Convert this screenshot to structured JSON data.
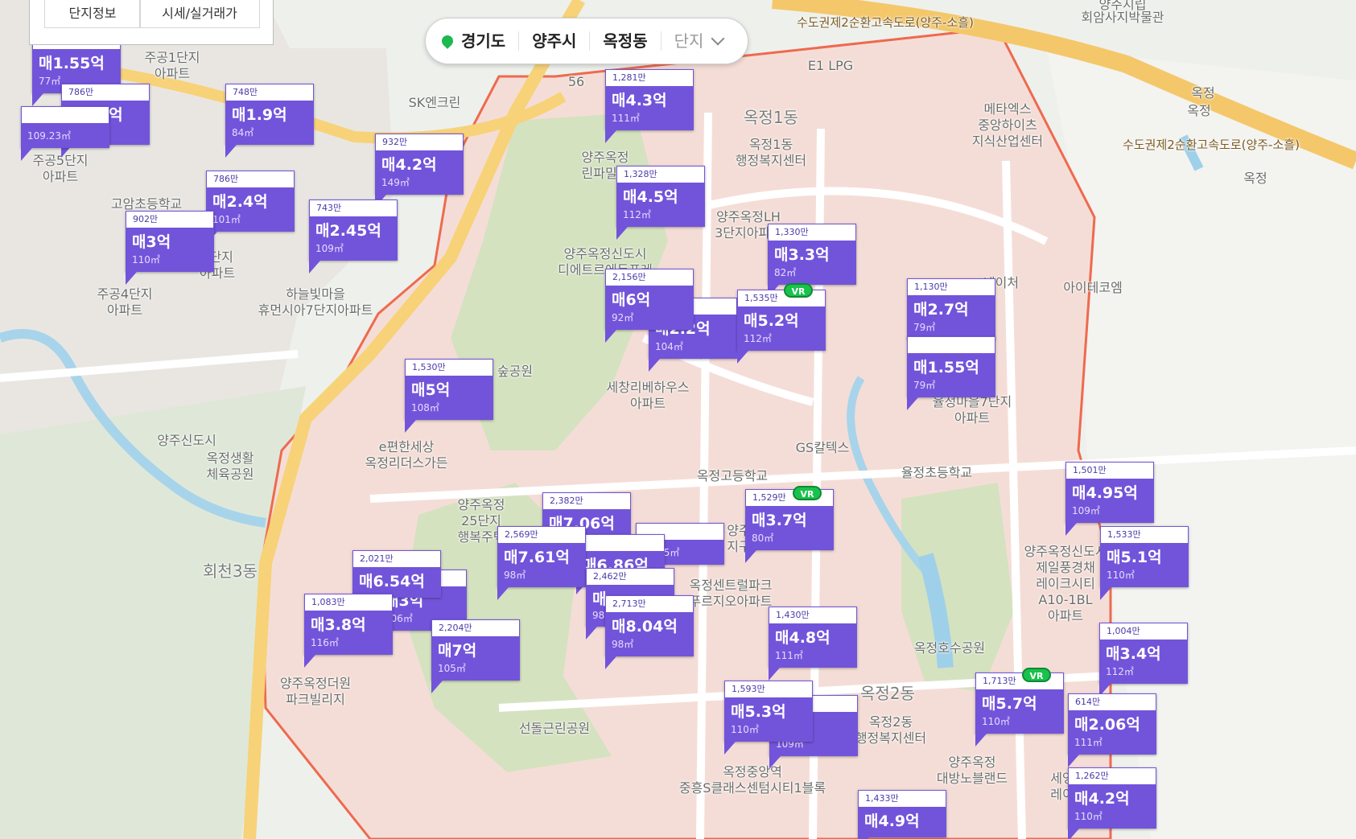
{
  "panel": {
    "tab_info": "단지정보",
    "tab_price": "시세/실거래가"
  },
  "region": {
    "province": "경기도",
    "city": "양주시",
    "dong": "옥정동",
    "complex_placeholder": "단지"
  },
  "vr_badge": "VR",
  "map_labels": [
    {
      "id": "road-expressway",
      "text": "수도권제2순환고속도로(양주-소흘)"
    },
    {
      "id": "museum",
      "text": "회암사지박물관"
    },
    {
      "id": "yangju-pass",
      "text": "양주시립"
    },
    {
      "id": "tg-okjeong-1",
      "text": "옥정"
    },
    {
      "id": "tg-okjeong-2",
      "text": "옥정"
    },
    {
      "id": "ic-okjeong",
      "text": "옥정"
    },
    {
      "id": "road-metro",
      "text": "수도권제2순환고속도로(양주-소흘)"
    },
    {
      "id": "e1-lpg",
      "text": "E1 LPG"
    },
    {
      "id": "sk-enclean",
      "text": "SK엔크린"
    },
    {
      "id": "jugong1",
      "text": "주공1단지\n아파트"
    },
    {
      "id": "jugong5",
      "text": "주공5단지\n아파트"
    },
    {
      "id": "goam-school",
      "text": "고암초등학교"
    },
    {
      "id": "jugong4",
      "text": "주공4단지\n아파트"
    },
    {
      "id": "jugong3",
      "text": "3단지\n아파트"
    },
    {
      "id": "haneulbit",
      "text": "하늘빛마을\n휴먼시아7단지아파트"
    },
    {
      "id": "okjeong1dong",
      "text": "옥정1동"
    },
    {
      "id": "okjeong1-center",
      "text": "옥정1동\n행정복지센터"
    },
    {
      "id": "meta-x",
      "text": "메타엑스\n중앙하이츠\n지식산업센터"
    },
    {
      "id": "rinpark",
      "text": "양주옥정\n린파밀리"
    },
    {
      "id": "lh3",
      "text": "양주옥정LH\n3단지아파트"
    },
    {
      "id": "dietre",
      "text": "양주옥정신도시\n디에트르에듀포레"
    },
    {
      "id": "aitechem",
      "text": "아이테코엠"
    },
    {
      "id": "nature",
      "text": "네이처"
    },
    {
      "id": "park-forest",
      "text": "숲공원"
    },
    {
      "id": "sechang",
      "text": "세창리베하우스\n아파트"
    },
    {
      "id": "yuljeong7",
      "text": "율정마을7단지\n아파트"
    },
    {
      "id": "yangju-newtown",
      "text": "양주신도시"
    },
    {
      "id": "okjeong-sports",
      "text": "옥정생활\n체육공원"
    },
    {
      "id": "epyeonhan",
      "text": "e편한세상\n옥정리더스가든"
    },
    {
      "id": "gs-caltex",
      "text": "GS칼텍스"
    },
    {
      "id": "okjeong-high",
      "text": "옥정고등학교"
    },
    {
      "id": "yuljeong-elem",
      "text": "율정초등학교"
    },
    {
      "id": "25danji",
      "text": "양주옥정\n25단지\n행복주택"
    },
    {
      "id": "hoecheon3",
      "text": "회천3동"
    },
    {
      "id": "jeil",
      "text": "양주옥정신도시\n제일풍경채\n레이크시티\nA10-1BL\n아파트"
    },
    {
      "id": "central-park",
      "text": "옥정센트럴파크\n푸르지오아파트"
    },
    {
      "id": "jigu",
      "text": "양주\n지구"
    },
    {
      "id": "lake-park",
      "text": "옥정호수공원"
    },
    {
      "id": "okjeong2dong",
      "text": "옥정2동"
    },
    {
      "id": "okjeong2-center",
      "text": "옥정2동\n행정복지센터"
    },
    {
      "id": "deowon",
      "text": "양주옥정더원\n파크빌리지"
    },
    {
      "id": "seondol",
      "text": "선돌근린공원"
    },
    {
      "id": "junghung",
      "text": "옥정중앙역\n중흥S클래스센텀시티1블록"
    },
    {
      "id": "daebang",
      "text": "양주옥정\n대방노블랜드"
    },
    {
      "id": "seyeong",
      "text": "세영\n레이"
    },
    {
      "id": "route56",
      "text": "56"
    }
  ],
  "listings": [
    {
      "id": "m01",
      "unit": "",
      "price": "매1.55억",
      "area": "77㎡"
    },
    {
      "id": "m02",
      "unit": "786만",
      "price": "매1.9억",
      "area": "82㎡"
    },
    {
      "id": "m03",
      "unit": "",
      "price": "",
      "area": "109.23㎡"
    },
    {
      "id": "m04",
      "unit": "748만",
      "price": "매1.9억",
      "area": "84㎡"
    },
    {
      "id": "m05",
      "unit": "932만",
      "price": "매4.2억",
      "area": "149㎡"
    },
    {
      "id": "m06",
      "unit": "786만",
      "price": "매2.4억",
      "area": "101㎡"
    },
    {
      "id": "m07",
      "unit": "743만",
      "price": "매2.45억",
      "area": "109㎡"
    },
    {
      "id": "m08",
      "unit": "902만",
      "price": "매3억",
      "area": "110㎡"
    },
    {
      "id": "m09",
      "unit": "1,281만",
      "price": "매4.3억",
      "area": "111㎡"
    },
    {
      "id": "m10",
      "unit": "1,328만",
      "price": "매4.5억",
      "area": "112㎡"
    },
    {
      "id": "m11",
      "unit": "1,330만",
      "price": "매3.3억",
      "area": "82㎡"
    },
    {
      "id": "m12",
      "unit": "",
      "price": "매2.2억",
      "area": "104㎡"
    },
    {
      "id": "m13",
      "unit": "2,156만",
      "price": "매6억",
      "area": "92㎡"
    },
    {
      "id": "m14",
      "unit": "1,535만",
      "price": "매5.2억",
      "area": "112㎡"
    },
    {
      "id": "m15",
      "unit": "1,130만",
      "price": "매2.7억",
      "area": "79㎡"
    },
    {
      "id": "m16",
      "unit": "",
      "price": "매1.55억",
      "area": "79㎡"
    },
    {
      "id": "m17",
      "unit": "1,530만",
      "price": "매5억",
      "area": "108㎡"
    },
    {
      "id": "m18",
      "unit": "1,501만",
      "price": "매4.95억",
      "area": "109㎡"
    },
    {
      "id": "m19",
      "unit": "1,533만",
      "price": "매5.1억",
      "area": "110㎡"
    },
    {
      "id": "m20",
      "unit": "2,382만",
      "price": "매7.06억",
      "area": ""
    },
    {
      "id": "m21",
      "unit": "",
      "price": "",
      "area": "98.85㎡"
    },
    {
      "id": "m22",
      "unit": "",
      "price": "매6.86억",
      "area": ""
    },
    {
      "id": "m23",
      "unit": "2,569만",
      "price": "매7.61억",
      "area": "98㎡"
    },
    {
      "id": "m24",
      "unit": "1,529만",
      "price": "매3.7억",
      "area": "80㎡"
    },
    {
      "id": "m25",
      "unit": "",
      "price": "매3억",
      "area": "106㎡"
    },
    {
      "id": "m26",
      "unit": "2,021만",
      "price": "매6.54억",
      "area": ""
    },
    {
      "id": "m27",
      "unit": "2,462만",
      "price": "매",
      "area": "98"
    },
    {
      "id": "m28",
      "unit": "2,713만",
      "price": "매8.04억",
      "area": "98㎡"
    },
    {
      "id": "m29",
      "unit": "1,083만",
      "price": "매3.8억",
      "area": "116㎡"
    },
    {
      "id": "m30",
      "unit": "2,204만",
      "price": "매7억",
      "area": "105㎡"
    },
    {
      "id": "m31",
      "unit": "1,430만",
      "price": "매4.8억",
      "area": "111㎡"
    },
    {
      "id": "m32",
      "unit": "1,004만",
      "price": "매3.4억",
      "area": "112㎡"
    },
    {
      "id": "m33",
      "unit": "",
      "price": "매",
      "area": "109㎡"
    },
    {
      "id": "m34",
      "unit": "1,593만",
      "price": "매5.3억",
      "area": "110㎡"
    },
    {
      "id": "m35",
      "unit": "1,713만",
      "price": "매5.7억",
      "area": "110㎡"
    },
    {
      "id": "m36",
      "unit": "614만",
      "price": "매2.06억",
      "area": "111㎡"
    },
    {
      "id": "m37",
      "unit": "1,262만",
      "price": "매4.2억",
      "area": "110㎡"
    },
    {
      "id": "m38",
      "unit": "1,433만",
      "price": "매4.9억",
      "area": ""
    }
  ],
  "colors": {
    "marker_fill": "#7254da",
    "district_fill": "#f5ddd7",
    "district_border": "#ee6a4e",
    "park": "#c7dbb8",
    "water": "#9fd0ea",
    "road_major": "#f4c76a"
  }
}
